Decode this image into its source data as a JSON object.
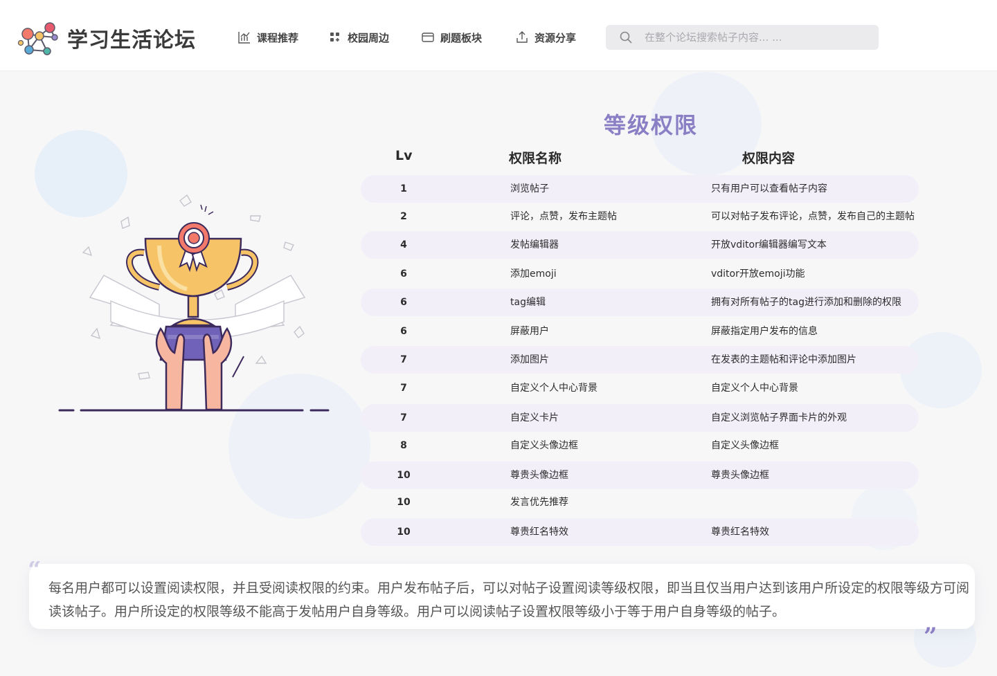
{
  "header": {
    "site_title": "学习生活论坛",
    "nav": [
      {
        "label": "课程推荐",
        "icon": "bar-chart-icon"
      },
      {
        "label": "校园周边",
        "icon": "grid-icon"
      },
      {
        "label": "刷题板块",
        "icon": "card-icon"
      },
      {
        "label": "资源分享",
        "icon": "upload-icon"
      }
    ],
    "search": {
      "placeholder": "在整个论坛搜索帖子内容... ..."
    }
  },
  "permissions": {
    "title": "等级权限",
    "columns": [
      "Lv",
      "权限名称",
      "权限内容"
    ],
    "rows": [
      {
        "lv": "1",
        "name": "浏览帖子",
        "desc": "只有用户可以查看帖子内容"
      },
      {
        "lv": "2",
        "name": "评论，点赞，发布主题帖",
        "desc": "可以对帖子发布评论，点赞，发布自己的主题帖"
      },
      {
        "lv": "4",
        "name": "发帖编辑器",
        "desc": "开放vditor编辑器编写文本"
      },
      {
        "lv": "6",
        "name": "添加emoji",
        "desc": "vditor开放emoji功能"
      },
      {
        "lv": "6",
        "name": "tag编辑",
        "desc": "拥有对所有帖子的tag进行添加和删除的权限"
      },
      {
        "lv": "6",
        "name": "屏蔽用户",
        "desc": "屏蔽指定用户发布的信息"
      },
      {
        "lv": "7",
        "name": "添加图片",
        "desc": "在发表的主题帖和评论中添加图片"
      },
      {
        "lv": "7",
        "name": "自定义个人中心背景",
        "desc": "自定义个人中心背景"
      },
      {
        "lv": "7",
        "name": "自定义卡片",
        "desc": "自定义浏览帖子界面卡片的外观"
      },
      {
        "lv": "8",
        "name": "自定义头像边框",
        "desc": "自定义头像边框"
      },
      {
        "lv": "10",
        "name": "尊贵头像边框",
        "desc": "尊贵头像边框"
      },
      {
        "lv": "10",
        "name": "发言优先推荐",
        "desc": ""
      },
      {
        "lv": "10",
        "name": "尊贵红名特效",
        "desc": "尊贵红名特效"
      }
    ]
  },
  "notice": {
    "text": "每名用户都可以设置阅读权限，并且受阅读权限的约束。用户发布帖子后，可以对帖子设置阅读等级权限，即当且仅当用户达到该用户所设定的权限等级方可阅读该帖子。用户所设定的权限等级不能高于发帖用户自身等级。用户可以阅读帖子设置权限等级小于等于用户自身等级的帖子。"
  },
  "colors": {
    "accent": "#8a7fc4",
    "row_highlight": "#f3eff9",
    "trophy_gold": "#f6c467",
    "trophy_purple": "#6f62b8",
    "outline": "#3d2a5c"
  }
}
